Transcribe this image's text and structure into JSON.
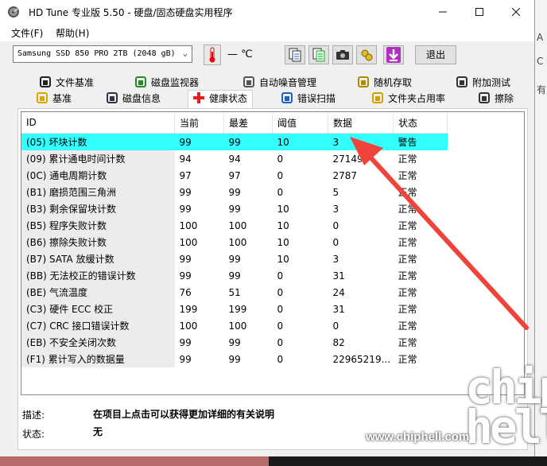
{
  "window": {
    "title": "HD Tune 专业版 5.50 - 硬盘/固态硬盘实用程序"
  },
  "menu": {
    "file": "文件(F)",
    "help": "帮助(H)"
  },
  "toolbar": {
    "drive": "Samsung SSD 850 PRO 2TB (2048 gB)",
    "temperature": "— ℃",
    "exit_label": "退出"
  },
  "tabs_row1": [
    "文件基准",
    "磁盘监视器",
    "自动噪音管理",
    "随机存取",
    "附加测试"
  ],
  "tabs_row2": [
    "基准",
    "磁盘信息",
    "健康状态",
    "错误扫描",
    "文件夹占用率",
    "擦除"
  ],
  "active_tab": "健康状态",
  "table": {
    "headers": [
      "ID",
      "当前",
      "最差",
      "阈值",
      "数据",
      "状态"
    ],
    "rows": [
      [
        "(05) 坏块计数",
        "99",
        "99",
        "10",
        "3",
        "警告"
      ],
      [
        "(09) 累计通电时间计数",
        "94",
        "94",
        "0",
        "27149",
        "正常"
      ],
      [
        "(0C) 通电周期计数",
        "97",
        "97",
        "0",
        "2787",
        "正常"
      ],
      [
        "(B1) 磨损范围三角洲",
        "99",
        "99",
        "0",
        "5",
        "正常"
      ],
      [
        "(B3) 剩余保留块计数",
        "99",
        "99",
        "10",
        "3",
        "正常"
      ],
      [
        "(B5) 程序失败计数",
        "100",
        "100",
        "10",
        "0",
        "正常"
      ],
      [
        "(B6) 擦除失败计数",
        "100",
        "100",
        "10",
        "0",
        "正常"
      ],
      [
        "(B7) SATA 放缓计数",
        "99",
        "99",
        "10",
        "3",
        "正常"
      ],
      [
        "(BB) 无法校正的错误计数",
        "99",
        "99",
        "0",
        "31",
        "正常"
      ],
      [
        "(BE) 气流温度",
        "76",
        "51",
        "0",
        "24",
        "正常"
      ],
      [
        "(C3) 硬件 ECC 校正",
        "199",
        "199",
        "0",
        "31",
        "正常"
      ],
      [
        "(C7) CRC 接口错误计数",
        "100",
        "100",
        "0",
        "0",
        "正常"
      ],
      [
        "(EB) 不安全关闭次数",
        "99",
        "99",
        "0",
        "82",
        "正常"
      ],
      [
        "(F1) 累计写入的数据量",
        "99",
        "99",
        "0",
        "22965219...",
        "正常"
      ]
    ]
  },
  "details": {
    "desc_label": "描述:",
    "desc_text": "在项目上点击可以获得更加详细的有关说明",
    "status_label": "状态:",
    "status_text": "无"
  },
  "background": {
    "edge_text_1": "A",
    "edge_text_2": "C",
    "edge_text_3": "有"
  },
  "watermark": {
    "url": "www.chiphell.com",
    "logo": "chip\nhell"
  },
  "colors": {
    "selected_row": "#33ffff",
    "arrow": "#f0443a"
  }
}
